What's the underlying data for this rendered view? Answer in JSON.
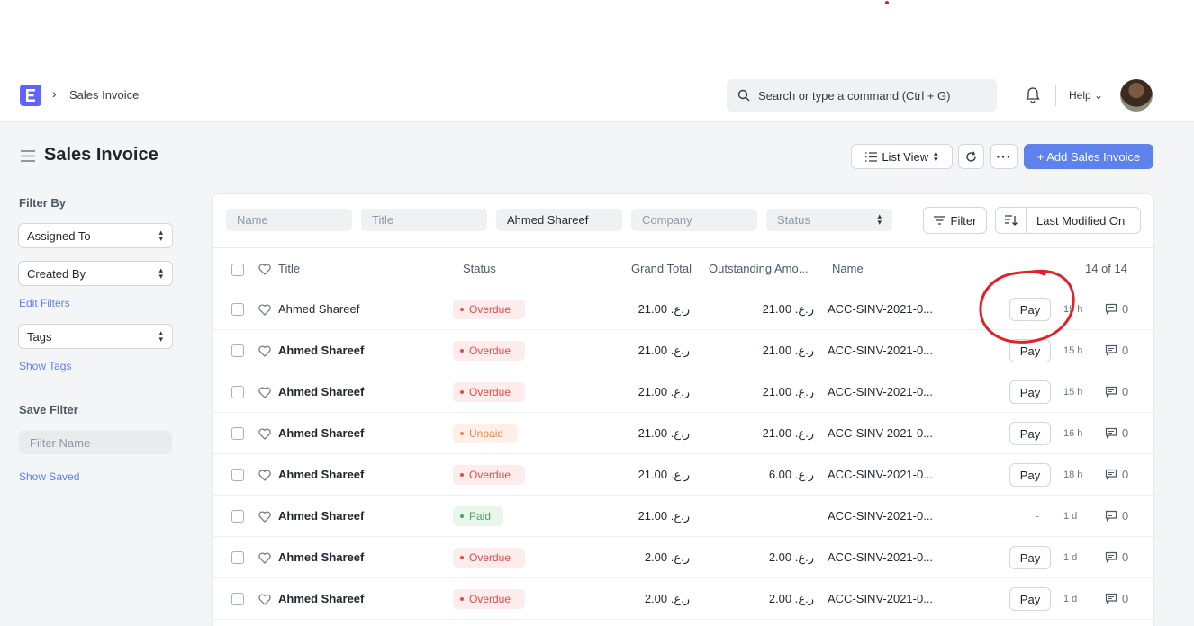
{
  "navbar": {
    "breadcrumb": "Sales Invoice",
    "search_placeholder": "Search or type a command (Ctrl + G)",
    "help_label": "Help"
  },
  "page": {
    "title": "Sales Invoice",
    "list_view_label": "List View",
    "add_button_label": "+ Add Sales Invoice"
  },
  "sidebar": {
    "filter_by_label": "Filter By",
    "assigned_to": "Assigned To",
    "created_by": "Created By",
    "edit_filters": "Edit Filters",
    "tags": "Tags",
    "show_tags": "Show Tags",
    "save_filter_label": "Save Filter",
    "filter_name_placeholder": "Filter Name",
    "show_saved": "Show Saved"
  },
  "filters": {
    "name_placeholder": "Name",
    "title_placeholder": "Title",
    "customer_value": "Ahmed Shareef",
    "company_placeholder": "Company",
    "status_placeholder": "Status",
    "filter_button": "Filter",
    "sort_label": "Last Modified On"
  },
  "table": {
    "headers": {
      "title": "Title",
      "status": "Status",
      "grand_total": "Grand Total",
      "outstanding": "Outstanding Amo...",
      "name": "Name",
      "count": "14 of 14"
    },
    "pay_label": "Pay",
    "rows": [
      {
        "title": "Ahmed Shareef",
        "status": "Overdue",
        "grand_total": "21.00 .ر.ع",
        "outstanding": "21.00 .ر.ع",
        "name": "ACC-SINV-2021-0...",
        "action": "Pay",
        "time": "15 h",
        "comments": "0"
      },
      {
        "title": "Ahmed Shareef",
        "status": "Overdue",
        "grand_total": "21.00 .ر.ع",
        "outstanding": "21.00 .ر.ع",
        "name": "ACC-SINV-2021-0...",
        "action": "Pay",
        "time": "15 h",
        "comments": "0"
      },
      {
        "title": "Ahmed Shareef",
        "status": "Overdue",
        "grand_total": "21.00 .ر.ع",
        "outstanding": "21.00 .ر.ع",
        "name": "ACC-SINV-2021-0...",
        "action": "Pay",
        "time": "15 h",
        "comments": "0"
      },
      {
        "title": "Ahmed Shareef",
        "status": "Unpaid",
        "grand_total": "21.00 .ر.ع",
        "outstanding": "21.00 .ر.ع",
        "name": "ACC-SINV-2021-0...",
        "action": "Pay",
        "time": "16 h",
        "comments": "0"
      },
      {
        "title": "Ahmed Shareef",
        "status": "Overdue",
        "grand_total": "21.00 .ر.ع",
        "outstanding": "6.00 .ر.ع",
        "name": "ACC-SINV-2021-0...",
        "action": "Pay",
        "time": "18 h",
        "comments": "0"
      },
      {
        "title": "Ahmed Shareef",
        "status": "Paid",
        "grand_total": "21.00 .ر.ع",
        "outstanding": "",
        "name": "ACC-SINV-2021-0...",
        "action": "-",
        "time": "1 d",
        "comments": "0"
      },
      {
        "title": "Ahmed Shareef",
        "status": "Overdue",
        "grand_total": "2.00 .ر.ع",
        "outstanding": "2.00 .ر.ع",
        "name": "ACC-SINV-2021-0...",
        "action": "Pay",
        "time": "1 d",
        "comments": "0"
      },
      {
        "title": "Ahmed Shareef",
        "status": "Overdue",
        "grand_total": "2.00 .ر.ع",
        "outstanding": "2.00 .ر.ع",
        "name": "ACC-SINV-2021-0...",
        "action": "Pay",
        "time": "1 d",
        "comments": "0"
      }
    ]
  },
  "colors": {
    "accent": "#5e82ec",
    "overdue": "#e24c4c",
    "unpaid": "#ec864b",
    "paid": "#48a55c",
    "annotation": "#e0202a"
  }
}
